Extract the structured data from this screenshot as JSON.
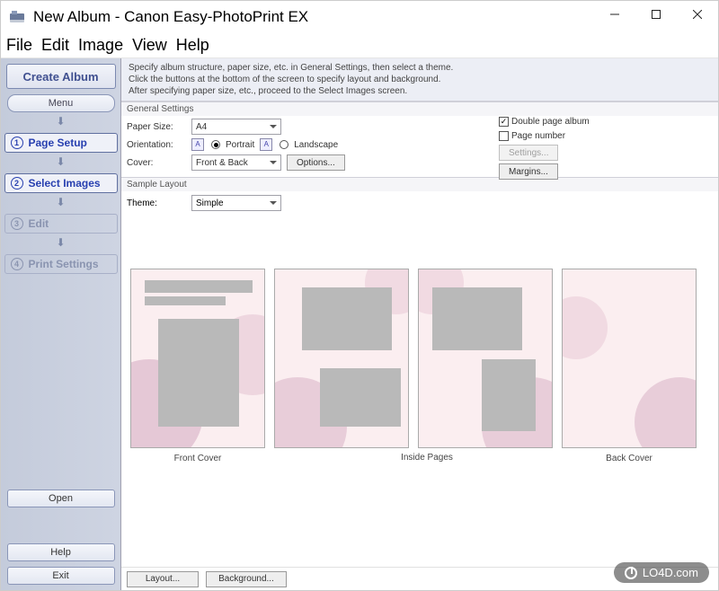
{
  "window": {
    "title": "New Album - Canon Easy-PhotoPrint EX"
  },
  "menubar": [
    "File",
    "Edit",
    "Image",
    "View",
    "Help"
  ],
  "sidebar": {
    "header": "Create Album",
    "menu_btn": "Menu",
    "steps": [
      {
        "num": "①",
        "label": "Page Setup",
        "active": true
      },
      {
        "num": "②",
        "label": "Select Images",
        "active": true
      },
      {
        "num": "③",
        "label": "Edit",
        "active": false
      },
      {
        "num": "④",
        "label": "Print Settings",
        "active": false
      }
    ],
    "open_btn": "Open",
    "help_btn": "Help",
    "exit_btn": "Exit"
  },
  "hint": {
    "line1": "Specify album structure, paper size, etc. in General Settings, then select a theme.",
    "line2": "Click the buttons at the bottom of the screen to specify layout and background.",
    "line3": "After specifying paper size, etc., proceed to the Select Images screen."
  },
  "general": {
    "title": "General Settings",
    "paper_size_label": "Paper Size:",
    "paper_size_value": "A4",
    "orientation_label": "Orientation:",
    "orientation_portrait": "Portrait",
    "orientation_landscape": "Landscape",
    "cover_label": "Cover:",
    "cover_value": "Front & Back",
    "options_btn": "Options...",
    "double_page": "Double page album",
    "page_number": "Page number",
    "settings_btn": "Settings...",
    "margins_btn": "Margins..."
  },
  "sample": {
    "title": "Sample Layout",
    "theme_label": "Theme:",
    "theme_value": "Simple",
    "front_cover": "Front Cover",
    "inside_pages": "Inside Pages",
    "back_cover": "Back Cover"
  },
  "bottom": {
    "layout_btn": "Layout...",
    "background_btn": "Background..."
  },
  "watermark": "LO4D.com"
}
